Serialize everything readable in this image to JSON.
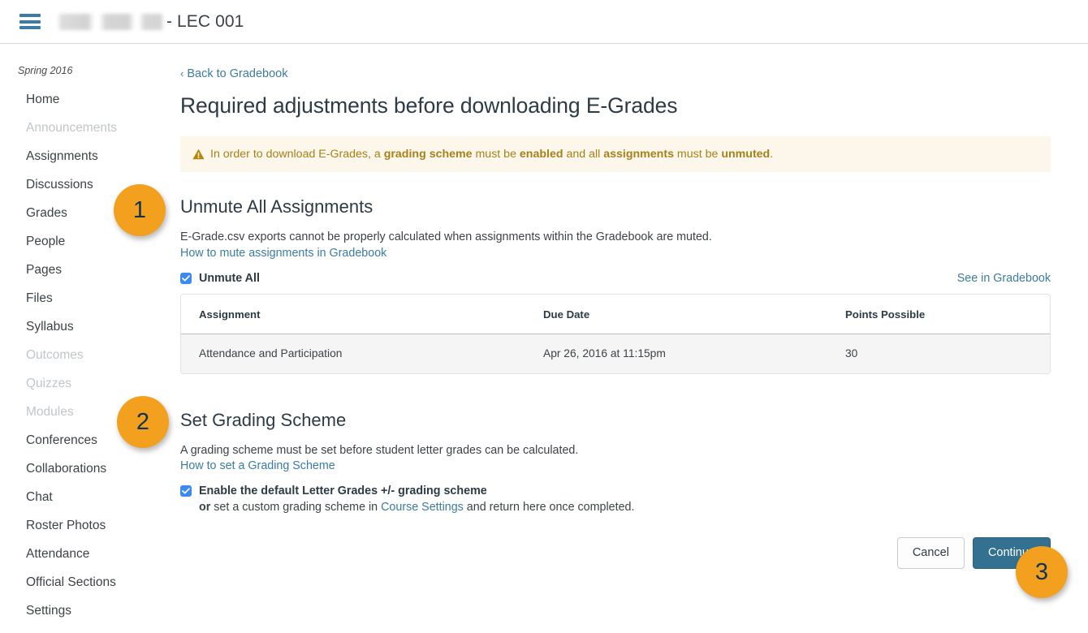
{
  "topbar": {
    "menu_icon": "hamburger-menu-icon",
    "course_name_redacted": "",
    "course_suffix": "- LEC 001"
  },
  "sidebar": {
    "term": "Spring 2016",
    "items": [
      {
        "label": "Home",
        "dim": false
      },
      {
        "label": "Announcements",
        "dim": true
      },
      {
        "label": "Assignments",
        "dim": false
      },
      {
        "label": "Discussions",
        "dim": false
      },
      {
        "label": "Grades",
        "dim": false
      },
      {
        "label": "People",
        "dim": false
      },
      {
        "label": "Pages",
        "dim": false
      },
      {
        "label": "Files",
        "dim": false
      },
      {
        "label": "Syllabus",
        "dim": false
      },
      {
        "label": "Outcomes",
        "dim": true
      },
      {
        "label": "Quizzes",
        "dim": true
      },
      {
        "label": "Modules",
        "dim": true
      },
      {
        "label": "Conferences",
        "dim": false
      },
      {
        "label": "Collaborations",
        "dim": false
      },
      {
        "label": "Chat",
        "dim": false
      },
      {
        "label": "Roster Photos",
        "dim": false
      },
      {
        "label": "Attendance",
        "dim": false
      },
      {
        "label": "Official Sections",
        "dim": false
      },
      {
        "label": "Settings",
        "dim": false
      }
    ]
  },
  "main": {
    "back_link": "Back to Gradebook",
    "back_chevron": "‹",
    "page_title": "Required adjustments before downloading E-Grades",
    "alert": {
      "icon": "warning-triangle-icon",
      "part1": "In order to download E-Grades, a ",
      "bold1": "grading scheme",
      "part2": " must be ",
      "bold2": "enabled",
      "part3": " and all ",
      "bold3": "assignments",
      "part4": " must be ",
      "bold4": "unmuted",
      "part5": "."
    },
    "unmute_section": {
      "title": "Unmute All Assignments",
      "description": "E-Grade.csv exports cannot be properly calculated when assignments within the Gradebook are muted.",
      "help_link": "How to mute assignments in Gradebook",
      "checkbox_label": "Unmute All",
      "checkbox_checked": true,
      "see_in_gradebook_link": "See in Gradebook",
      "table": {
        "headers": [
          "Assignment",
          "Due Date",
          "Points Possible"
        ],
        "rows": [
          [
            "Attendance and Participation",
            "Apr 26, 2016 at 11:15pm",
            "30"
          ]
        ]
      }
    },
    "scheme_section": {
      "title": "Set Grading Scheme",
      "description": "A grading scheme must be set before student letter grades can be calculated.",
      "help_link": "How to set a Grading Scheme",
      "checkbox_label": "Enable the default Letter Grades +/- grading scheme",
      "checkbox_checked": true,
      "sub_or": "or",
      "sub_text_1": " set a custom grading scheme in ",
      "sub_link": "Course Settings",
      "sub_text_2": " and return here once completed."
    },
    "buttons": {
      "cancel": "Cancel",
      "continue": "Continue"
    }
  },
  "annotations": [
    {
      "number": "1"
    },
    {
      "number": "2"
    },
    {
      "number": "3"
    }
  ],
  "colors": {
    "link": "#3a7ca5",
    "alert_bg": "#fcf7ea",
    "alert_text": "#a8811a",
    "primary_button": "#34708f",
    "checkbox": "#3c8af0",
    "badge": "#f2a01e",
    "badge_text": "#123352"
  }
}
